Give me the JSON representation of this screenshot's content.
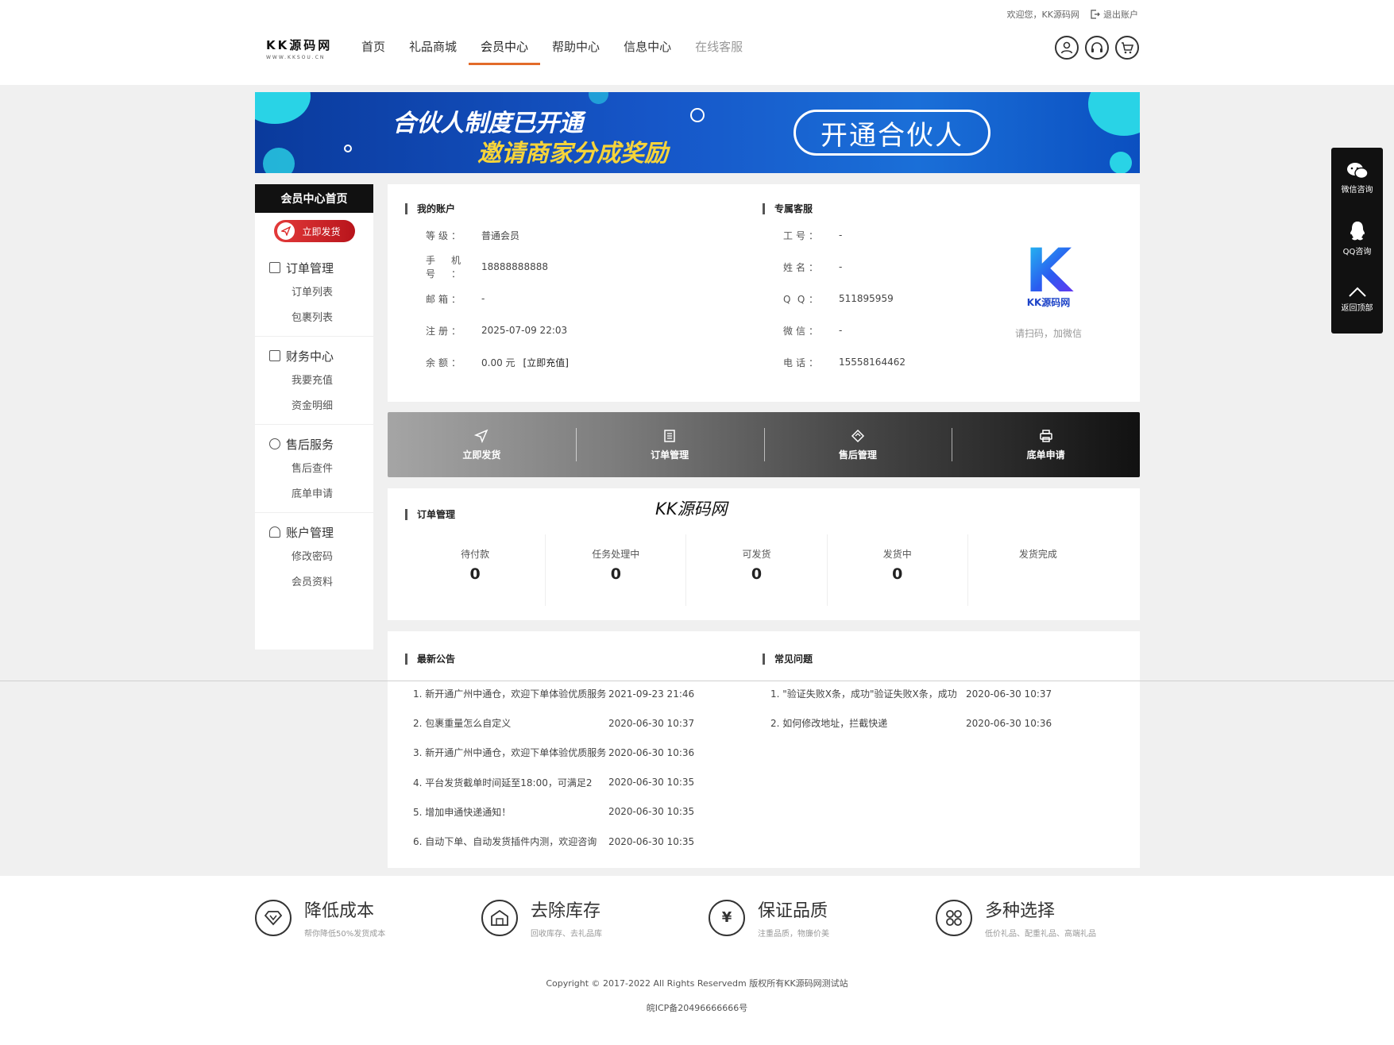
{
  "topbar": {
    "welcome": "欢迎您，KK源码网",
    "logout": "退出账户"
  },
  "logo": {
    "name": "KK源码网",
    "sub": "WWW.KKSOU.CN"
  },
  "nav": [
    {
      "label": "首页"
    },
    {
      "label": "礼品商城"
    },
    {
      "label": "会员中心"
    },
    {
      "label": "帮助中心"
    },
    {
      "label": "信息中心"
    },
    {
      "label": "在线客服"
    }
  ],
  "banner": {
    "line1": "合伙人制度已开通",
    "line2": "邀请商家分成奖励",
    "cta": "开通合伙人"
  },
  "sidebar": {
    "home": "会员中心首页",
    "send": "立即发货",
    "groups": [
      {
        "title": "订单管理",
        "items": [
          "订单列表",
          "包裹列表"
        ]
      },
      {
        "title": "财务中心",
        "items": [
          "我要充值",
          "资金明细"
        ]
      },
      {
        "title": "售后服务",
        "items": [
          "售后查件",
          "底单申请"
        ]
      },
      {
        "title": "账户管理",
        "items": [
          "修改密码",
          "会员资料"
        ]
      }
    ]
  },
  "account": {
    "title": "我的账户",
    "rows": [
      {
        "k": "等级：",
        "v": "普通会员"
      },
      {
        "k": "手机号：",
        "v": "18888888888"
      },
      {
        "k": "邮箱：",
        "v": "-"
      },
      {
        "k": "注册：",
        "v": "2025-07-09 22:03"
      },
      {
        "k": "余额：",
        "v": "0.00 元",
        "extra": "[立即充值]"
      }
    ]
  },
  "service": {
    "title": "专属客服",
    "rows": [
      {
        "k": "工号：",
        "v": "-"
      },
      {
        "k": "姓名：",
        "v": "-"
      },
      {
        "k": "Q Q：",
        "v": "511895959"
      },
      {
        "k": "微信：",
        "v": "-"
      },
      {
        "k": "电话：",
        "v": "15558164462"
      }
    ],
    "qr_letter": "K",
    "qr_name": "KK源码网",
    "qr_tip": "请扫码，加微信"
  },
  "quickbar": [
    {
      "label": "立即发货",
      "icon": "send-icon"
    },
    {
      "label": "订单管理",
      "icon": "list-icon"
    },
    {
      "label": "售后管理",
      "icon": "diamond-icon"
    },
    {
      "label": "底单申请",
      "icon": "printer-icon"
    }
  ],
  "orders": {
    "title": "订单管理",
    "watermark": "KK源码网",
    "stats": [
      {
        "label": "待付款",
        "value": "0"
      },
      {
        "label": "任务处理中",
        "value": "0"
      },
      {
        "label": "可发货",
        "value": "0"
      },
      {
        "label": "发货中",
        "value": "0"
      },
      {
        "label": "发货完成",
        "value": ""
      }
    ]
  },
  "notices": {
    "title": "最新公告",
    "items": [
      {
        "title": "1. 新开通广州中通仓，欢迎下单体验优质服务",
        "date": "2021-09-23 21:46"
      },
      {
        "title": "2. 包裹重量怎么自定义",
        "date": "2020-06-30 10:37"
      },
      {
        "title": "3. 新开通广州中通仓，欢迎下单体验优质服务",
        "date": "2020-06-30 10:36"
      },
      {
        "title": "4. 平台发货截单时间延至18:00，可满足2",
        "date": "2020-06-30 10:35"
      },
      {
        "title": "5. 增加申通快递通知！",
        "date": "2020-06-30 10:35"
      },
      {
        "title": "6. 自动下单、自动发货插件内测，欢迎咨询",
        "date": "2020-06-30 10:35"
      }
    ]
  },
  "faq": {
    "title": "常见问题",
    "items": [
      {
        "title": "1. \"验证失败X条，成功\"验证失败X条，成功",
        "date": "2020-06-30 10:37"
      },
      {
        "title": "2. 如何修改地址，拦截快递",
        "date": "2020-06-30 10:36"
      }
    ]
  },
  "float": [
    {
      "label": "微信咨询",
      "icon": "wechat-icon"
    },
    {
      "label": "QQ咨询",
      "icon": "qq-icon"
    },
    {
      "label": "返回顶部",
      "icon": "chevron-up-icon"
    }
  ],
  "features": [
    {
      "title": "降低成本",
      "desc": "帮你降低50%发货成本",
      "icon": "diamond-icon"
    },
    {
      "title": "去除库存",
      "desc": "回收库存、去礼品库",
      "icon": "warehouse-icon"
    },
    {
      "title": "保证品质",
      "desc": "注重品质，物廉价美",
      "icon": "yen-shield-icon"
    },
    {
      "title": "多种选择",
      "desc": "低价礼品、配重礼品、高端礼品",
      "icon": "grid-icon"
    }
  ],
  "footer": {
    "copyright": "Copyright © 2017-2022 All Rights Reservedm 版权所有KK源码网测试站",
    "icp": "皖ICP备20496666666号"
  },
  "colors": {
    "accent": "#e26b2a",
    "banner": "#1656c8",
    "send_red": "#d22a2a"
  }
}
